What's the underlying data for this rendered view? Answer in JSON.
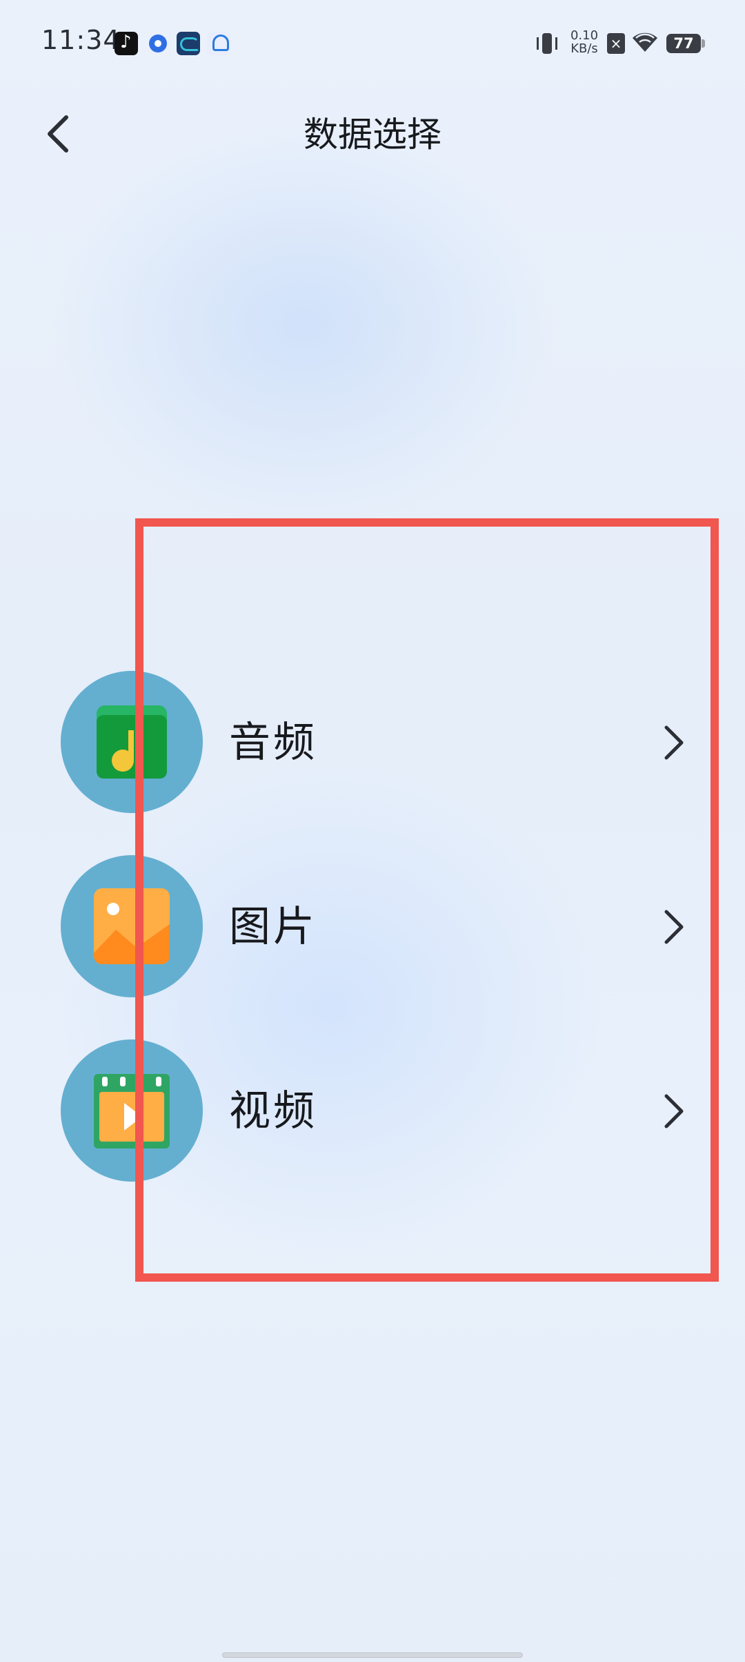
{
  "status_bar": {
    "time": "11:34",
    "notification_icons": [
      "tiktok-icon",
      "circle-app-icon",
      "blue-app-icon",
      "cloud-app-icon"
    ],
    "net_speed_value": "0.10",
    "net_speed_unit": "KB/s",
    "battery_level": "77",
    "sim_mark": "×"
  },
  "header": {
    "back_icon": "chevron-left-icon",
    "title": "数据选择"
  },
  "items": [
    {
      "label": "音频",
      "icon": "audio-file-icon",
      "chevron": "chevron-right-icon"
    },
    {
      "label": "图片",
      "icon": "image-file-icon",
      "chevron": "chevron-right-icon"
    },
    {
      "label": "视频",
      "icon": "video-file-icon",
      "chevron": "chevron-right-icon"
    }
  ],
  "colors": {
    "circle_bg": "#64afd0",
    "highlight_border": "#f1564f",
    "audio_icon": "#1aa04a",
    "image_icon": "#ffa53a",
    "video_icon": "#2fa564"
  }
}
